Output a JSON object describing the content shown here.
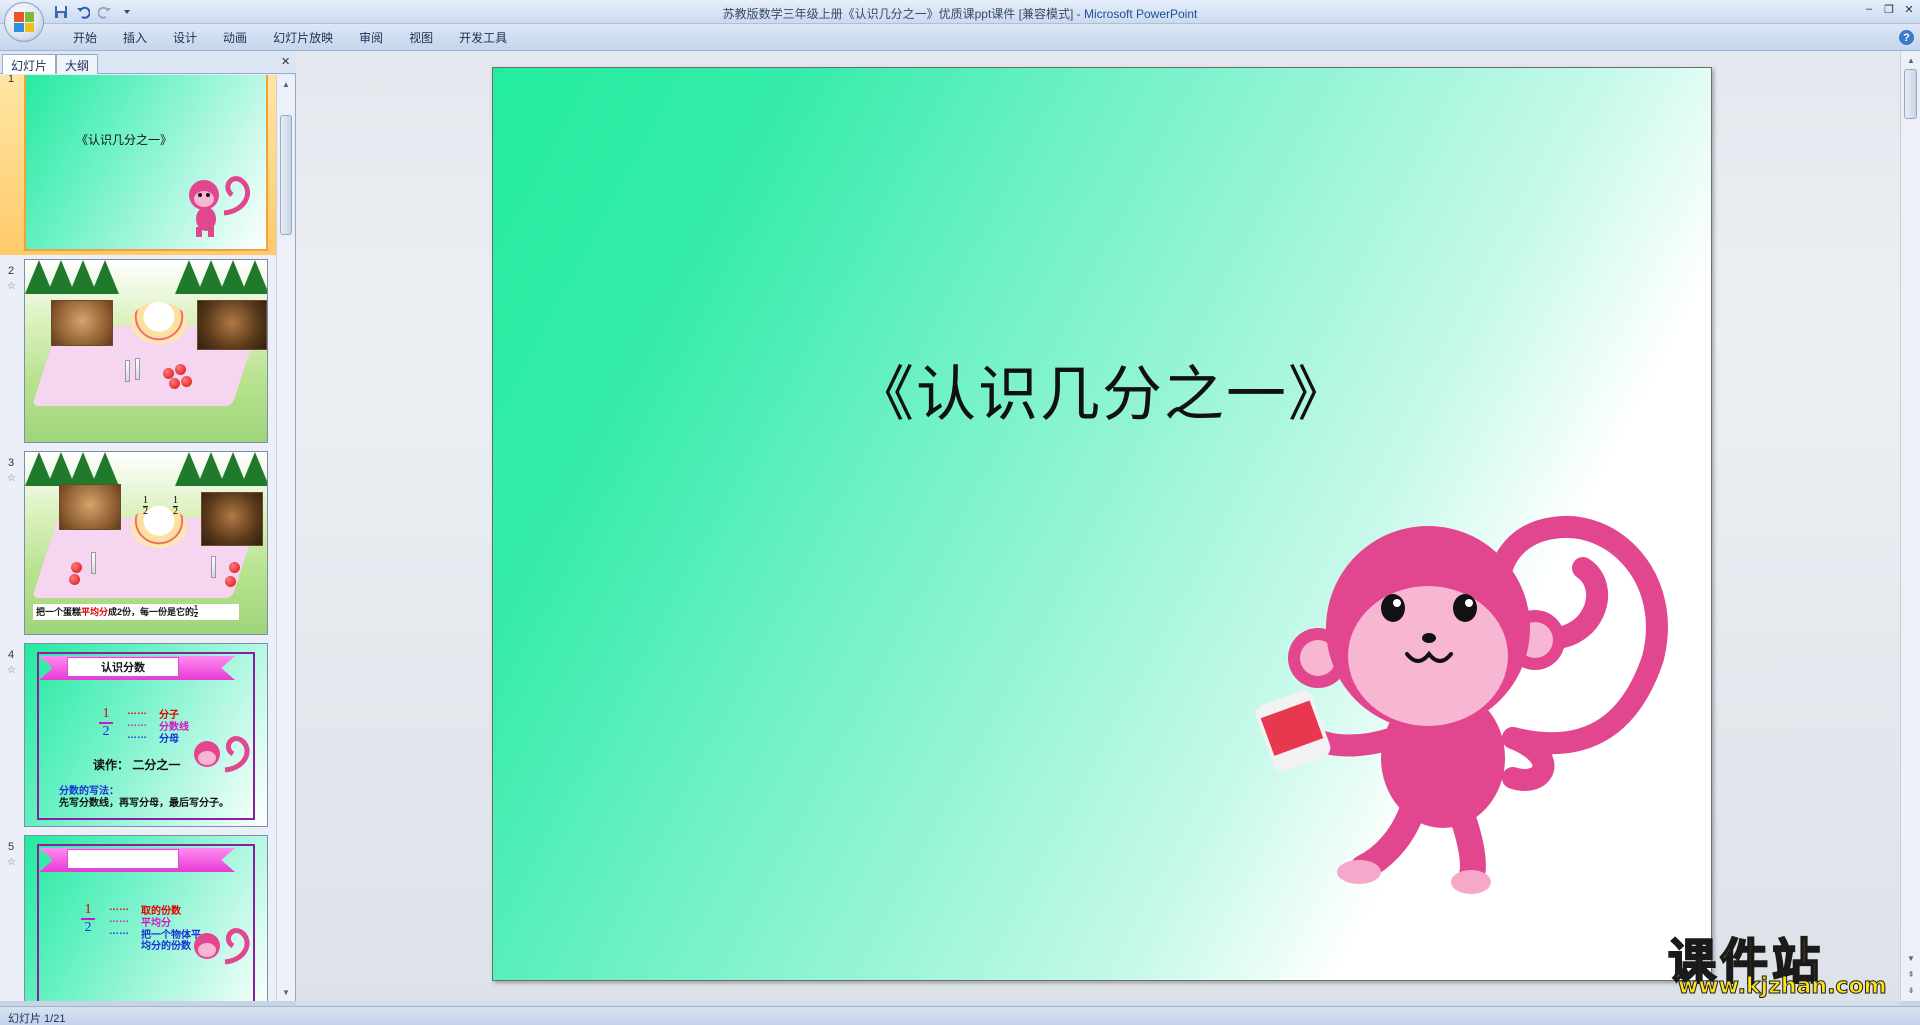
{
  "window": {
    "title_doc": "苏教版数学三年级上册《认识几分之一》优质课ppt课件 [兼容模式] - ",
    "title_app": "Microsoft PowerPoint",
    "controls": [
      "–",
      "❐",
      "✕"
    ]
  },
  "qat": {
    "icons": [
      "save-icon",
      "undo-icon",
      "redo-icon",
      "customize-icon"
    ]
  },
  "ribbon": {
    "tabs": [
      "开始",
      "插入",
      "设计",
      "动画",
      "幻灯片放映",
      "审阅",
      "视图",
      "开发工具"
    ]
  },
  "panel": {
    "tab_slides": "幻灯片",
    "tab_outline": "大纲",
    "close": "×",
    "thumbs": [
      {
        "num": "1",
        "title": "《认识几分之一》"
      },
      {
        "num": "2"
      },
      {
        "num": "3",
        "caption_prefix": "把一个蛋糕",
        "caption_red": "平均分",
        "caption_suffix": "成2份，每一份是它的",
        "frac_num": "1",
        "frac_den": "2",
        "frac_num_top": "1",
        "frac_den_top": "2"
      },
      {
        "num": "4",
        "banner": "认识分数",
        "frac_num": "1",
        "frac_den": "2",
        "dots1": "……",
        "dots2": "……",
        "dots3": "……",
        "lbl1": "分子",
        "lbl2": "分数线",
        "lbl3": "分母",
        "read": "读作：  二分之一",
        "write_title": "分数的写法：",
        "write_text": "先写分数线，再写分母，最后写分子。"
      },
      {
        "num": "5",
        "frac_num": "1",
        "frac_den": "2",
        "dots1": "……",
        "dots2": "……",
        "dots3": "……",
        "lbl1": "取的份数",
        "lbl2": "平均分",
        "lbl3a": "把一个物体平",
        "lbl3b": "均分的份数"
      }
    ]
  },
  "slide": {
    "title": "《认识几分之一》"
  },
  "status": {
    "text": "幻灯片 1/21"
  },
  "watermark": {
    "main": "课件站",
    "url": "www.kjzhan.com"
  },
  "colors": {
    "accent_mint": "#23ec9f",
    "monkey_pink": "#e2468f",
    "watermark_yellow": "#ffe21a"
  }
}
